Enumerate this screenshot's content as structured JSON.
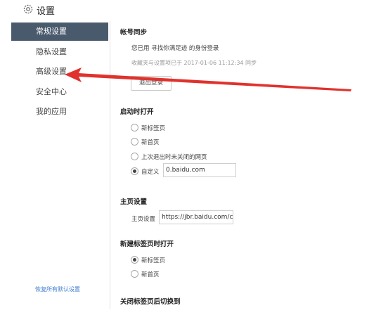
{
  "header": {
    "title": "设置",
    "icon": "gear-icon"
  },
  "sidebar": {
    "items": [
      {
        "label": "常规设置",
        "active": true
      },
      {
        "label": "隐私设置"
      },
      {
        "label": "高级设置"
      },
      {
        "label": "安全中心"
      },
      {
        "label": "我的应用"
      }
    ],
    "restore_link": "恢复所有默认设置"
  },
  "account_sync": {
    "title": "帐号同步",
    "logged_in_text": "您已用 寻找你满足迹 的身份登录",
    "sync_status": "收藏夹与设置项已于 2017-01-06 11:12:34 同步",
    "logout_button": "退出登录"
  },
  "startup": {
    "title": "启动时打开",
    "options": [
      "新标签页",
      "新首页",
      "上次退出时未关闭的网页",
      "自定义"
    ],
    "selected_index": 3,
    "custom_value": "0.baidu.com"
  },
  "homepage": {
    "title": "主页设置",
    "label": "主页设置",
    "value": "https://jbr.baidu.com/c"
  },
  "new_tab": {
    "title": "新建标签页时打开",
    "options": [
      "新标签页",
      "新首页"
    ],
    "selected_index": 0
  },
  "close_tab": {
    "title": "关闭标签页后切换到"
  },
  "colors": {
    "sidebar_active": "#4a5a6d",
    "link": "#3f7bd0",
    "annotation_arrow": "#e0322d"
  }
}
